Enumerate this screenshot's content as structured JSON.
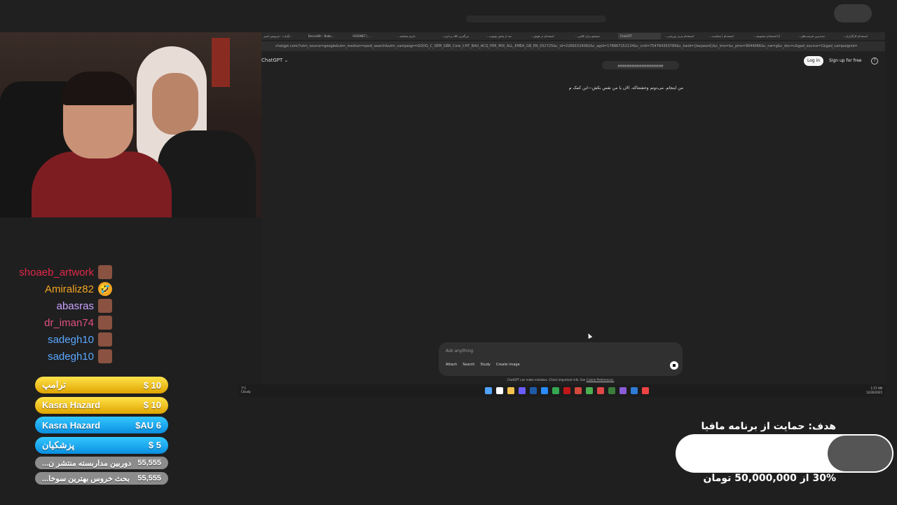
{
  "browser": {
    "tabs": [
      "آپارات - سرویس اشتر...",
      "DeviceBh - Baba...",
      "VISIONET | ...",
      "...داریم مسابقه",
      "...بزرگترین کلاه برداری",
      "...بعد از پخش یوتیوب",
      "...استخدام در هوش",
      "...جستجو برای کلاس",
      "ChatGPT",
      "...استخدام مربی ورزشی",
      "...استخدام | محاسب",
      "...آیا استخدام مجموعه",
      "...جدیدترین فرصت‌های",
      "...استخدام کارگزاران"
    ],
    "url": "chatgpt.com/?utm_source=google&utm_medium=paid_search&utm_campaign=GOOG_C_SEM_GBR_Core_CHT_BAU_ACQ_PER_MIX_ALL_EMEA_GB_EN_052725&c_id=22681529082&c_agid=178867152134&c_crid=754784350789&c_kwid={keyword}&c_ims=&c_pms=9044066&c_nw=g&c_dvc=c&gad_source=1&gad_campaignid=22681529082&gbraid=",
    "app_title": "ChatGPT ⌄",
    "login_label": "Log in",
    "signup_label": "Sign up for free",
    "help_label": "?",
    "user_message": "ووووووووووووووووووووووووووو",
    "assistant_reply": "من اینجام. می‌دونم وحشتناکه. الان یا من نفس بکش—این کمک م",
    "composer_placeholder": "Ask anything",
    "tools": [
      "Attach",
      "Search",
      "Study",
      "Create image"
    ],
    "disclaimer": "ChatGPT can make mistakes. Check important info. See",
    "disclaimer_link": "Cookie Preferences."
  },
  "taskbar": {
    "temp": "7°C",
    "weather": "Cloudy",
    "time": "1:57 AM",
    "date": "12/26/2025",
    "icons": [
      "#4fa3ff",
      "#ffffff",
      "#f2c14e",
      "#6b5cff",
      "#1f5aa6",
      "#2a8cff",
      "#34a853",
      "#c01818",
      "#d14b3e",
      "#4caf50",
      "#e04848",
      "#3b7d3a",
      "#8a5bd6",
      "#2e7bd6",
      "#e44"
    ]
  },
  "chat": [
    {
      "name": "shoaeb_artwork",
      "color": "#e0284a",
      "emote": ""
    },
    {
      "name": "Amiraliz82",
      "color": "#f2a623",
      "emote": "🤣"
    },
    {
      "name": "abasras",
      "color": "#c9a3ff",
      "emote": ""
    },
    {
      "name": "dr_iman74",
      "color": "#e05080",
      "emote": ""
    },
    {
      "name": "sadegh10",
      "color": "#5aa8ff",
      "emote": ""
    },
    {
      "name": "sadegh10",
      "color": "#5aa8ff",
      "emote": ""
    }
  ],
  "donations": [
    {
      "name": "ترامپ",
      "amount": "$ 10",
      "style": "gold"
    },
    {
      "name": "Kasra Hazard",
      "amount": "$ 10",
      "style": "gold"
    },
    {
      "name": "Kasra Hazard",
      "amount": "$AU 6",
      "style": "blue"
    },
    {
      "name": "پزشکیان",
      "amount": "$ 5",
      "style": "blue"
    },
    {
      "name": "دوربین مداربسته منتشر ن...",
      "amount": "55,555",
      "style": "gray"
    },
    {
      "name": "بحث خروس بهترین سوخا...",
      "amount": "55,555",
      "style": "gray"
    }
  ],
  "goal": {
    "title": "هدف: حمایت از برنامه مافیا",
    "amount_text": "30% از 50,000,000 تومان",
    "progress_fraction": 0.3
  }
}
